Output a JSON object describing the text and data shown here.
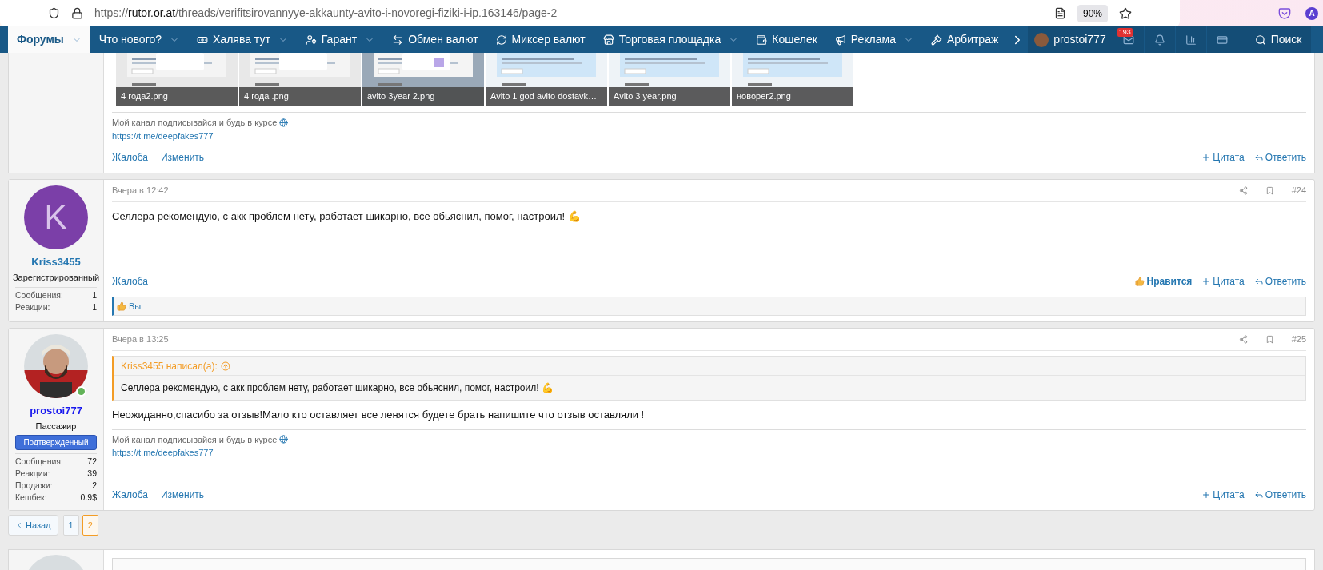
{
  "browser": {
    "url_prefix": "https://",
    "url_domain": "rutor.or.at",
    "url_path": "/threads/verifitsirovannyye-akkaunty-avito-i-novoregi-fiziki-i-ip.163146/page-2",
    "zoom": "90%",
    "profile": "A"
  },
  "nav": {
    "items": [
      {
        "label": "Форумы",
        "dropdown": true,
        "selected": true
      },
      {
        "label": "Что нового?",
        "dropdown": true,
        "selected": false
      },
      {
        "label": "Халява тут",
        "dropdown": true,
        "selected": false
      },
      {
        "label": "Гарант",
        "dropdown": true,
        "selected": false
      },
      {
        "label": "Обмен валют",
        "dropdown": false,
        "selected": false
      },
      {
        "label": "Миксер валют",
        "dropdown": false,
        "selected": false
      },
      {
        "label": "Торговая площадка",
        "dropdown": true,
        "selected": false
      },
      {
        "label": "Кошелек",
        "dropdown": false,
        "selected": false
      },
      {
        "label": "Реклама",
        "dropdown": true,
        "selected": false
      },
      {
        "label": "Арбитраж",
        "dropdown": false,
        "selected": false
      }
    ],
    "user": "prostoi777",
    "inbox_count": "193",
    "search": "Поиск"
  },
  "posts": [
    {
      "kind": "continuation",
      "attachments": [
        "4 года2.png",
        "4 года .png",
        "avito 3year 2.png",
        "Avito 1 god avito dostavk…",
        "Avito 3 year.png",
        "новорег2.png"
      ],
      "signature": "Мой канал подписывайся и будь в курсе",
      "signature_link": "https://t.me/deepfakes777",
      "actions_left": [
        "Жалоба",
        "Изменить"
      ],
      "actions_right": [
        {
          "kind": "quote",
          "label": "Цитата"
        },
        {
          "kind": "reply",
          "label": "Ответить"
        }
      ]
    },
    {
      "kind": "post",
      "author": {
        "name": "Kriss3455",
        "letter": "K",
        "title": "Зарегистрированный",
        "online": false,
        "stats": [
          {
            "label": "Сообщения:",
            "value": "1"
          },
          {
            "label": "Реакции:",
            "value": "1"
          }
        ]
      },
      "date": "Вчера в 12:42",
      "number": "#24",
      "body": "Селлера рекомендую, с акк проблем нету, работает шикарно, все обьяснил, помог, настроил! 💪",
      "actions_left": [
        "Жалоба"
      ],
      "actions_right": [
        {
          "kind": "like",
          "label": "Нравится"
        },
        {
          "kind": "quote",
          "label": "Цитата"
        },
        {
          "kind": "reply",
          "label": "Ответить"
        }
      ],
      "reactions": "Вы"
    },
    {
      "kind": "post",
      "author": {
        "name": "prostoi777",
        "title": "Пассажир",
        "online": true,
        "banner": "Подтвержденный",
        "stats": [
          {
            "label": "Сообщения:",
            "value": "72"
          },
          {
            "label": "Реакции:",
            "value": "39"
          },
          {
            "label": "Продажи:",
            "value": "2"
          },
          {
            "label": "Кешбек:",
            "value": "0.9$"
          }
        ]
      },
      "date": "Вчера в 13:25",
      "number": "#25",
      "quote": {
        "author": "Kriss3455 написал(а):",
        "text": "Селлера рекомендую, с акк проблем нету, работает шикарно, все обьяснил, помог, настроил! 💪"
      },
      "body": "Неожиданно,спасибо за отзыв!Мало кто оставляет все ленятся будете брать напишите что отзыв оставляли !",
      "signature": "Мой канал подписывайся и будь в курсе",
      "signature_link": "https://t.me/deepfakes777",
      "actions_left": [
        "Жалоба",
        "Изменить"
      ],
      "actions_right": [
        {
          "kind": "quote",
          "label": "Цитата"
        },
        {
          "kind": "reply",
          "label": "Ответить"
        }
      ]
    }
  ],
  "pagination": {
    "back": "Назад",
    "pages": [
      {
        "label": "1",
        "selected": false
      },
      {
        "label": "2",
        "selected": true
      }
    ]
  }
}
